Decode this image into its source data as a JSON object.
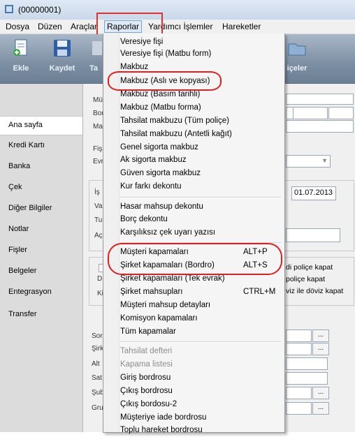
{
  "window": {
    "title": "(00000001)"
  },
  "menubar": {
    "items": [
      "Dosya",
      "Düzen",
      "Araçlar",
      "Raporlar",
      "Yardımcı İşlemler",
      "Hareketler"
    ]
  },
  "toolbar": {
    "buttons": [
      {
        "label": "Ekle",
        "icon": "add-document-icon"
      },
      {
        "label": "Kaydet",
        "icon": "save-icon"
      },
      {
        "label": "Ta",
        "icon": "partial-icon"
      }
    ],
    "right_label": "içeler"
  },
  "sidebar": {
    "items": [
      "Ana sayfa",
      "Kredi Kartı",
      "Banka",
      "Çek",
      "Diğer Bilgiler",
      "Notlar",
      "Fişler",
      "Belgeler",
      "Entegrasyon",
      "Transfer"
    ],
    "selected": "Ana sayfa"
  },
  "main": {
    "labels": [
      "Mü",
      "Bor",
      "Mak",
      "Fiş",
      "Evr",
      "İş",
      "Va",
      "Tu",
      "Aç",
      "D",
      "Ki",
      "Sor",
      "Şirk",
      "Alt",
      "Sat",
      "Şub",
      "Gru"
    ],
    "date_value": "01.07.2013",
    "right_text_1": "di poliçe kapat",
    "right_text_2": "poliçe kapat",
    "right_text_3": "viz ile döviz kapat",
    "ellipsis": "..."
  },
  "dropdown": {
    "groups": [
      [
        {
          "label": "Veresiye fişi"
        },
        {
          "label": "Veresiye fişi (Matbu form)"
        },
        {
          "label": "Makbuz"
        },
        {
          "label": "Makbuz (Aslı ve kopyası)"
        },
        {
          "label": "Makbuz (Basım tarihli)"
        },
        {
          "label": "Makbuz (Matbu forma)"
        },
        {
          "label": "Tahsilat makbuzu (Tüm poliçe)"
        },
        {
          "label": "Tahsilat makbuzu (Antetli kağıt)"
        },
        {
          "label": "Genel sigorta makbuz"
        },
        {
          "label": "Ak sigorta makbuz"
        },
        {
          "label": "Güven sigorta makbuz"
        },
        {
          "label": "Kur farkı dekontu"
        }
      ],
      [
        {
          "label": "Hasar mahsup dekontu"
        },
        {
          "label": "Borç dekontu"
        },
        {
          "label": "Karşılıksız çek uyarı yazısı"
        }
      ],
      [
        {
          "label": "Müşteri kapamaları",
          "shortcut": "ALT+P"
        },
        {
          "label": "Şirket kapamaları (Bordro)",
          "shortcut": "ALT+S"
        },
        {
          "label": "Şirket kapamaları (Tek evrak)"
        },
        {
          "label": "Şirket mahsupları",
          "shortcut": "CTRL+M"
        },
        {
          "label": "Müşteri mahsup detayları"
        },
        {
          "label": "Komisyon kapamaları"
        },
        {
          "label": "Tüm kapamalar"
        }
      ],
      [
        {
          "label": "Tahsilat defteri",
          "disabled": true
        },
        {
          "label": "Kapama listesi",
          "disabled": true
        },
        {
          "label": "Giriş bordrosu"
        },
        {
          "label": "Çıkış bordrosu"
        },
        {
          "label": "Çıkış bordosu-2"
        },
        {
          "label": "Müşteriye iade bordrosu"
        },
        {
          "label": "Toplu hareket bordrosu"
        }
      ]
    ]
  },
  "colors": {
    "highlight": "#e02020",
    "toolbar": "#7d8fa3",
    "sidebar": "#dcdcdc"
  }
}
